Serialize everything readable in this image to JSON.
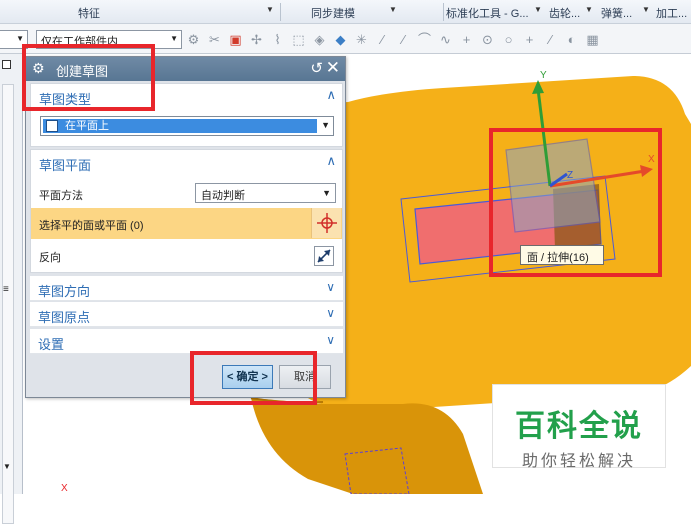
{
  "ribbon": {
    "feature_group": "特征",
    "sync_group": "同步建模",
    "std_tools": "标准化工具 - G...",
    "gear": "齿轮...",
    "spring": "弹簧...",
    "process": "加工..."
  },
  "toolbar": {
    "scope_value": "仅在工作部件内"
  },
  "dialog": {
    "title": "创建草图",
    "sections": {
      "type": {
        "label": "草图类型",
        "selected": "在平面上"
      },
      "plane": {
        "label": "草图平面",
        "method_label": "平面方法",
        "method_value": "自动判断",
        "select_label": "选择平的面或平面 (0)",
        "reverse_label": "反向"
      },
      "orientation": {
        "label": "草图方向"
      },
      "origin": {
        "label": "草图原点"
      },
      "settings": {
        "label": "设置"
      }
    },
    "ok_label": "< 确定 >",
    "cancel_label": "取消"
  },
  "viewport": {
    "tooltip": "面 / 拉伸(16)",
    "axis_x": "X",
    "axis_y": "Y",
    "axis_z": "Z",
    "origin_x": "X"
  },
  "watermark": {
    "title": "百科全说",
    "subtitle": "助你轻松解决"
  },
  "colors": {
    "part": "#f5b018",
    "highlight_red": "#e8262b",
    "accent_blue": "#2e6db4",
    "select_orange": "#fcd684"
  }
}
